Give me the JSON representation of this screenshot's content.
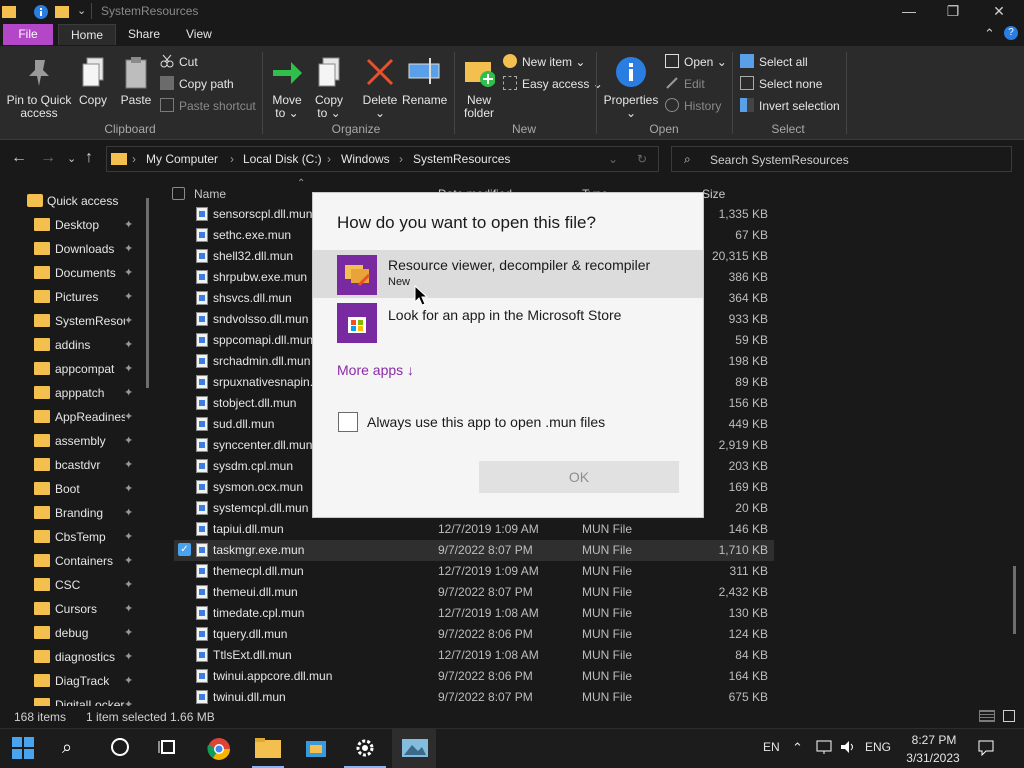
{
  "window": {
    "title": "SystemResources"
  },
  "tabs": [
    "File",
    "Home",
    "Share",
    "View"
  ],
  "ribbon": {
    "clipboard": {
      "pin": "Pin to Quick access",
      "pin_line1": "Pin to Quick",
      "pin_line2": "access",
      "copy": "Copy",
      "paste": "Paste",
      "cut": "Cut",
      "copy_path": "Copy path",
      "paste_shortcut": "Paste shortcut",
      "label": "Clipboard"
    },
    "organize": {
      "move_to1": "Move",
      "move_to2": "to",
      "copy_to1": "Copy",
      "copy_to2": "to",
      "delete": "Delete",
      "rename": "Rename",
      "label": "Organize"
    },
    "new": {
      "new_folder1": "New",
      "new_folder2": "folder",
      "new_item": "New item",
      "easy_access": "Easy access",
      "label": "New"
    },
    "open": {
      "properties": "Properties",
      "open": "Open",
      "edit": "Edit",
      "history": "History",
      "label": "Open"
    },
    "select": {
      "select_all": "Select all",
      "select_none": "Select none",
      "invert": "Invert selection",
      "label": "Select"
    }
  },
  "address": {
    "crumbs": [
      "My Computer",
      "Local Disk (C:)",
      "Windows",
      "SystemResources"
    ],
    "search_placeholder": "Search SystemResources"
  },
  "columns": {
    "name": "Name",
    "date": "Date modified",
    "type": "Type",
    "size": "Size"
  },
  "sidebar": [
    {
      "label": "Quick access",
      "pinned": false
    },
    {
      "label": "Desktop",
      "pinned": true
    },
    {
      "label": "Downloads",
      "pinned": true
    },
    {
      "label": "Documents",
      "pinned": true
    },
    {
      "label": "Pictures",
      "pinned": true
    },
    {
      "label": "SystemResources",
      "pinned": true
    },
    {
      "label": "addins",
      "pinned": true
    },
    {
      "label": "appcompat",
      "pinned": true
    },
    {
      "label": "apppatch",
      "pinned": true
    },
    {
      "label": "AppReadiness",
      "pinned": true
    },
    {
      "label": "assembly",
      "pinned": true
    },
    {
      "label": "bcastdvr",
      "pinned": true
    },
    {
      "label": "Boot",
      "pinned": true
    },
    {
      "label": "Branding",
      "pinned": true
    },
    {
      "label": "CbsTemp",
      "pinned": true
    },
    {
      "label": "Containers",
      "pinned": true
    },
    {
      "label": "CSC",
      "pinned": true
    },
    {
      "label": "Cursors",
      "pinned": true
    },
    {
      "label": "debug",
      "pinned": true
    },
    {
      "label": "diagnostics",
      "pinned": true
    },
    {
      "label": "DiagTrack",
      "pinned": true
    },
    {
      "label": "DigitalLocker",
      "pinned": true
    }
  ],
  "files": [
    {
      "name": "sensorscpl.dll.mun",
      "date": "",
      "type": "",
      "size": "1,335 KB"
    },
    {
      "name": "sethc.exe.mun",
      "date": "",
      "type": "",
      "size": "67 KB"
    },
    {
      "name": "shell32.dll.mun",
      "date": "",
      "type": "",
      "size": "20,315 KB"
    },
    {
      "name": "shrpubw.exe.mun",
      "date": "",
      "type": "",
      "size": "386 KB"
    },
    {
      "name": "shsvcs.dll.mun",
      "date": "",
      "type": "",
      "size": "364 KB"
    },
    {
      "name": "sndvolsso.dll.mun",
      "date": "",
      "type": "",
      "size": "933 KB"
    },
    {
      "name": "sppcomapi.dll.mun",
      "date": "",
      "type": "",
      "size": "59 KB"
    },
    {
      "name": "srchadmin.dll.mun",
      "date": "",
      "type": "",
      "size": "198 KB"
    },
    {
      "name": "srpuxnativesnapin.dll.mun",
      "date": "",
      "type": "",
      "size": "89 KB"
    },
    {
      "name": "stobject.dll.mun",
      "date": "",
      "type": "",
      "size": "156 KB"
    },
    {
      "name": "sud.dll.mun",
      "date": "",
      "type": "",
      "size": "449 KB"
    },
    {
      "name": "synccenter.dll.mun",
      "date": "",
      "type": "",
      "size": "2,919 KB"
    },
    {
      "name": "sysdm.cpl.mun",
      "date": "",
      "type": "",
      "size": "203 KB"
    },
    {
      "name": "sysmon.ocx.mun",
      "date": "",
      "type": "",
      "size": "169 KB"
    },
    {
      "name": "systemcpl.dll.mun",
      "date": "",
      "type": "",
      "size": "20 KB"
    },
    {
      "name": "tapiui.dll.mun",
      "date": "12/7/2019 1:09 AM",
      "type": "MUN File",
      "size": "146 KB"
    },
    {
      "name": "taskmgr.exe.mun",
      "date": "9/7/2022 8:07 PM",
      "type": "MUN File",
      "size": "1,710 KB",
      "selected": true
    },
    {
      "name": "themecpl.dll.mun",
      "date": "12/7/2019 1:09 AM",
      "type": "MUN File",
      "size": "311 KB"
    },
    {
      "name": "themeui.dll.mun",
      "date": "9/7/2022 8:07 PM",
      "type": "MUN File",
      "size": "2,432 KB"
    },
    {
      "name": "timedate.cpl.mun",
      "date": "12/7/2019 1:08 AM",
      "type": "MUN File",
      "size": "130 KB"
    },
    {
      "name": "tquery.dll.mun",
      "date": "9/7/2022 8:06 PM",
      "type": "MUN File",
      "size": "124 KB"
    },
    {
      "name": "TtlsExt.dll.mun",
      "date": "12/7/2019 1:08 AM",
      "type": "MUN File",
      "size": "84 KB"
    },
    {
      "name": "twinui.appcore.dll.mun",
      "date": "9/7/2022 8:06 PM",
      "type": "MUN File",
      "size": "164 KB"
    },
    {
      "name": "twinui.dll.mun",
      "date": "9/7/2022 8:07 PM",
      "type": "MUN File",
      "size": "675 KB"
    }
  ],
  "status": {
    "items": "168 items",
    "selected": "1 item selected 1.66 MB"
  },
  "dialog": {
    "title": "How do you want to open this file?",
    "app1_name": "Resource viewer, decompiler & recompiler",
    "app1_sub": "New",
    "app2_name": "Look for an app in the Microsoft Store",
    "more_apps": "More apps ↓",
    "always": "Always use this app to open .mun files",
    "ok": "OK"
  },
  "taskbar": {
    "lang_short": "EN",
    "lang": "ENG",
    "time": "8:27 PM",
    "date": "3/31/2023"
  },
  "colors": {
    "accent": "#b446c8",
    "folder": "#f3c04f",
    "link": "#8a2aa8",
    "file_tab": "#b446c8"
  }
}
